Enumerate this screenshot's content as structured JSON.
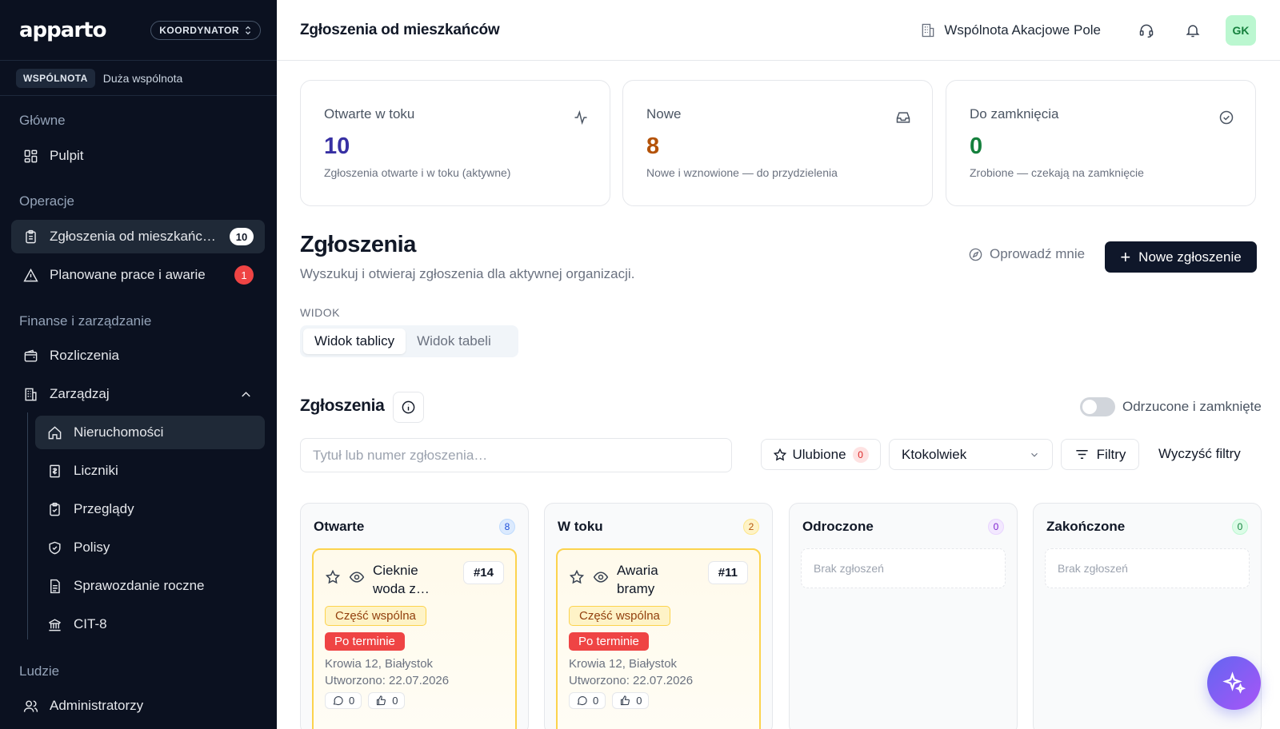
{
  "brand": {
    "logo": "apparto",
    "role": "KOORDYNATOR"
  },
  "org": {
    "tag": "WSPÓLNOTA",
    "name": "Duża wspólnota"
  },
  "sidebar": {
    "sections": [
      "Główne",
      "Operacje",
      "Finanse i zarządzanie",
      "Ludzie"
    ],
    "items": [
      {
        "label": "Pulpit",
        "icon": "dashboard-icon"
      },
      {
        "label": "Zgłoszenia od mieszkańców",
        "icon": "clipboard-icon",
        "badge": "10",
        "active": true
      },
      {
        "label": "Planowane prace i awarie",
        "icon": "warning-icon",
        "badge": "1"
      },
      {
        "label": "Rozliczenia",
        "icon": "wallet-icon"
      },
      {
        "label": "Zarządzaj",
        "icon": "building-icon",
        "expanded": true
      },
      {
        "label": "Nieruchomości",
        "icon": "home-icon",
        "active": true
      },
      {
        "label": "Liczniki",
        "icon": "meter-icon"
      },
      {
        "label": "Przeglądy",
        "icon": "clipboard-check-icon"
      },
      {
        "label": "Polisy",
        "icon": "shield-icon"
      },
      {
        "label": "Sprawozdanie roczne",
        "icon": "document-icon"
      },
      {
        "label": "CIT-8",
        "icon": "bank-icon"
      },
      {
        "label": "Administratorzy",
        "icon": "users-icon"
      }
    ]
  },
  "topbar": {
    "title": "Zgłoszenia od mieszkańców",
    "org_switch": "Wspólnota Akacjowe Pole",
    "avatar": "GK"
  },
  "stats": [
    {
      "label": "Otwarte w toku",
      "value": "10",
      "desc": "Zgłoszenia otwarte i w toku (aktywne)",
      "color": "#3730a3",
      "icon": "activity-icon"
    },
    {
      "label": "Nowe",
      "value": "8",
      "desc": "Nowe i wznowione — do przydzielenia",
      "color": "#b45309",
      "icon": "inbox-icon"
    },
    {
      "label": "Do zamknięcia",
      "value": "0",
      "desc": "Zrobione — czekają na zamknięcie",
      "color": "#15803d",
      "icon": "check-circle-icon"
    }
  ],
  "header": {
    "title": "Zgłoszenia",
    "subtitle": "Wyszukuj i otwieraj zgłoszenia dla aktywnej organizacji.",
    "guide": "Oprowadź mnie",
    "new_button": "Nowe zgłoszenie"
  },
  "view": {
    "label": "WIDOK",
    "board": "Widok tablicy",
    "table": "Widok tabeli",
    "selected": "board"
  },
  "board": {
    "title": "Zgłoszenia",
    "toggle_label": "Odrzucone i zamknięte",
    "toggle_on": false,
    "search_placeholder": "Tytuł lub numer zgłoszenia…",
    "favorites": "Ulubione",
    "favorites_count": "0",
    "assignee": "Ktokolwiek",
    "filters": "Filtry",
    "clear": "Wyczyść filtry",
    "empty_text": "Brak zgłoszeń",
    "columns": [
      {
        "title": "Otwarte",
        "count": "8"
      },
      {
        "title": "W toku",
        "count": "2"
      },
      {
        "title": "Odroczone",
        "count": "0"
      },
      {
        "title": "Zakończone",
        "count": "0"
      }
    ],
    "cards": [
      {
        "title": "Cieknie woda z…",
        "id": "#14",
        "category": "Część wspólna",
        "status": "Po terminie",
        "address": "Krowia 12, Białystok",
        "created": "Utworzono: 22.07.2026",
        "comments": "0",
        "reactions": "0"
      },
      {
        "title": "Awaria bramy",
        "id": "#11",
        "category": "Część wspólna",
        "status": "Po terminie",
        "address": "Krowia 12, Białystok",
        "created": "Utworzono: 22.07.2026",
        "comments": "0",
        "reactions": "0"
      }
    ]
  }
}
